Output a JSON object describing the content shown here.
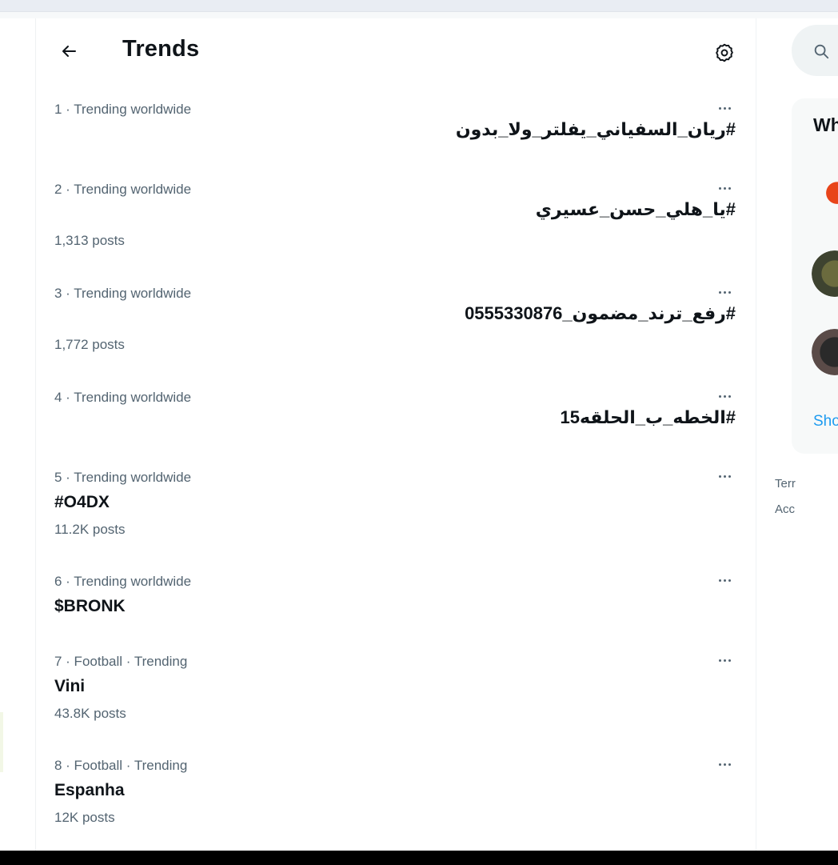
{
  "header": {
    "title": "Trends"
  },
  "trends": [
    {
      "meta": "1 · Trending worldwide",
      "name": "#ريان_السفياني_يفلتر_ولا_بدون",
      "posts": ""
    },
    {
      "meta": "2 · Trending worldwide",
      "name": "#يا_هلي_حسن_عسيري",
      "posts": "1,313 posts"
    },
    {
      "meta": "3 · Trending worldwide",
      "name": "#رفع_ترند_مضمون_0555330876",
      "posts": "1,772 posts"
    },
    {
      "meta": "4 · Trending worldwide",
      "name": "#الخطه_ب_الحلقه15",
      "posts": ""
    },
    {
      "meta": "5 · Trending worldwide",
      "name": "#O4DX",
      "posts": "11.2K posts"
    },
    {
      "meta": "6 · Trending worldwide",
      "name": "$BRONK",
      "posts": ""
    },
    {
      "meta": "7 · Football · Trending",
      "name": "Vini",
      "posts": "43.8K posts"
    },
    {
      "meta": "8 · Football · Trending",
      "name": "Espanha",
      "posts": "12K posts"
    }
  ],
  "sidebar": {
    "who_to_follow_title": "Wh",
    "show_more": "Sho",
    "footer_links": [
      "Terr",
      "Acc"
    ]
  },
  "icons": {
    "back": "arrow-left-icon",
    "settings": "gear-icon",
    "more": "more-horizontal-icon",
    "search": "search-icon"
  },
  "colors": {
    "text_primary": "#0f1419",
    "text_secondary": "#536471",
    "link": "#1d9bf0"
  }
}
